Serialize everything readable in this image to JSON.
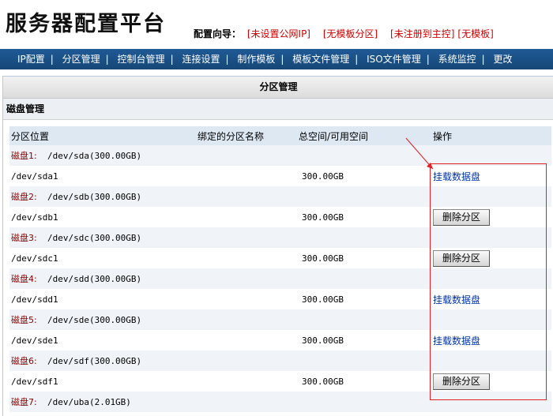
{
  "app": {
    "title": "服务器配置平台"
  },
  "wizard": {
    "label": "配置向导：",
    "items": [
      {
        "text": "[未设置公网IP]"
      },
      {
        "text": "[无模板分区]"
      },
      {
        "text": "[未注册到主控]"
      },
      {
        "text": "[无模板]"
      }
    ]
  },
  "nav": {
    "items": [
      {
        "label": "IP配置"
      },
      {
        "label": "分区管理"
      },
      {
        "label": "控制台管理"
      },
      {
        "label": "连接设置"
      },
      {
        "label": "制作模板"
      },
      {
        "label": "模板文件管理"
      },
      {
        "label": "ISO文件管理"
      },
      {
        "label": "系统监控"
      },
      {
        "label": "更改"
      }
    ]
  },
  "panel": {
    "title": "分区管理",
    "section": "磁盘管理"
  },
  "table": {
    "headers": [
      "分区位置",
      "绑定的分区名称",
      "总空间/可用空间",
      "操作"
    ],
    "mount_label": "挂载数据盘",
    "delete_label": "删除分区",
    "disks": [
      {
        "label": "磁盘1:",
        "device": "/dev/sda(300.00GB)",
        "partition": "/dev/sda1",
        "size": "300.00GB",
        "action": "挂载数据盘"
      },
      {
        "label": "磁盘2:",
        "device": "/dev/sdb(300.00GB)",
        "partition": "/dev/sdb1",
        "size": "300.00GB",
        "action": "删除分区"
      },
      {
        "label": "磁盘3:",
        "device": "/dev/sdc(300.00GB)",
        "partition": "/dev/sdc1",
        "size": "300.00GB",
        "action": "删除分区"
      },
      {
        "label": "磁盘4:",
        "device": "/dev/sdd(300.00GB)",
        "partition": "/dev/sdd1",
        "size": "300.00GB",
        "action": "挂载数据盘"
      },
      {
        "label": "磁盘5:",
        "device": "/dev/sde(300.00GB)",
        "partition": "/dev/sde1",
        "size": "300.00GB",
        "action": "挂载数据盘"
      },
      {
        "label": "磁盘6:",
        "device": "/dev/sdf(300.00GB)",
        "partition": "/dev/sdf1",
        "size": "300.00GB",
        "action": "删除分区"
      },
      {
        "label": "磁盘7:",
        "device": "/dev/uba(2.01GB)"
      }
    ]
  },
  "colors": {
    "nav_bg": "#1a4f86",
    "annotation": "#e02020",
    "disk_label": "#880000",
    "link": "#0033aa"
  }
}
